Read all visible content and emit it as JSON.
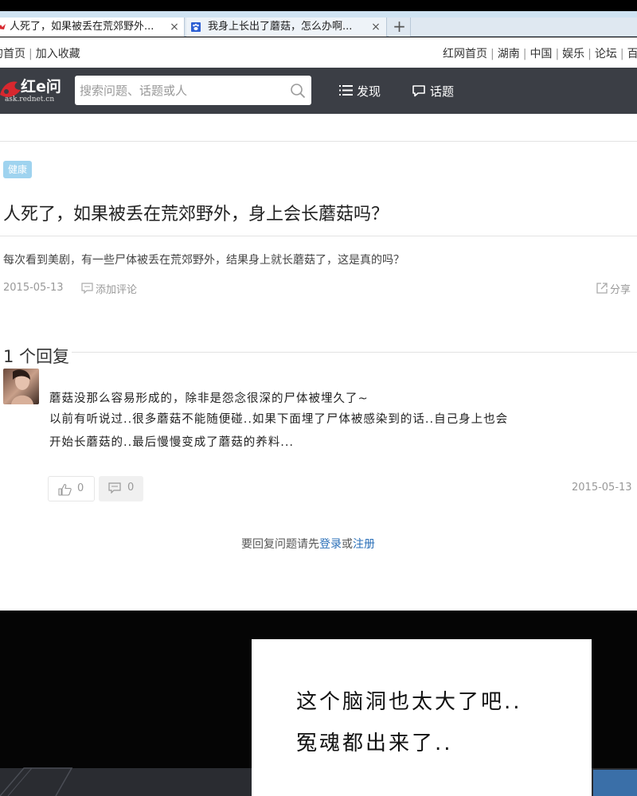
{
  "browser": {
    "tabs": [
      {
        "title": "人死了，如果被丢在荒郊野外...",
        "active": true,
        "favicon": "rednet-icon"
      },
      {
        "title": "我身上长出了蘑菇，怎么办啊...",
        "active": false,
        "favicon": "baidu-paw-icon"
      }
    ],
    "close_glyph": "×",
    "new_tab_glyph": "+"
  },
  "site_links": {
    "left": [
      "的首页",
      "加入收藏"
    ],
    "right": [
      "红网首页",
      "湖南",
      "中国",
      "娱乐",
      "论坛",
      "百"
    ],
    "separator": "|"
  },
  "header": {
    "logo_main": "红e问",
    "logo_sub": "ask.rednet.cn",
    "search_placeholder": "搜索问题、话题或人",
    "nav": [
      {
        "label": "发现",
        "icon": "list-icon"
      },
      {
        "label": "话题",
        "icon": "chat-bubble-icon"
      }
    ],
    "bg_color": "#3b3e45"
  },
  "question": {
    "tag": "健康",
    "title": "人死了，如果被丢在荒郊野外，身上会长蘑菇吗？",
    "description": "每次看到美剧，有一些尸体被丢在荒郊野外，结果身上就长蘑菇了，这是真的吗？",
    "date": "2015-05-13",
    "add_comment": "添加评论",
    "share": "分享"
  },
  "replies": {
    "count_label": "1 个回复",
    "items": [
      {
        "lines": [
          "蘑菇没那么容易形成的，除非是怨念很深的尸体被埋久了~",
          "以前有听说过..很多蘑菇不能随便碰..如果下面埋了尸体被感染到的话..自己身上也会",
          "开始长蘑菇的..最后慢慢变成了蘑菇的养料..."
        ],
        "votes": "0",
        "comments": "0",
        "date": "2015-05-13"
      }
    ]
  },
  "login_tip": {
    "prefix": "要回复问题请先",
    "login": "登录",
    "or": "或",
    "register": "注册"
  },
  "caption": {
    "line1": "这个脑洞也太大了吧..",
    "line2": "冤魂都出来了.."
  },
  "colors": {
    "tag_bg": "#9fd3ef",
    "link": "#2a6fb8",
    "brand_red": "#d7282f"
  }
}
